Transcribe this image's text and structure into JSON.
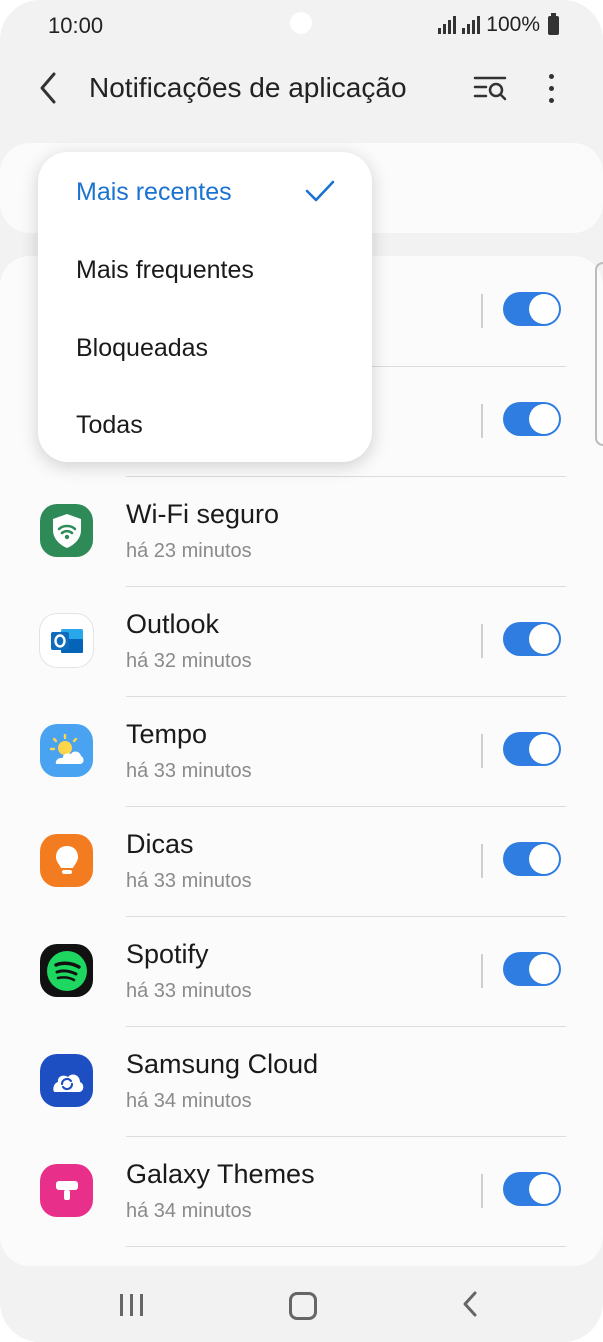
{
  "status_bar": {
    "time": "10:00",
    "battery": "100%"
  },
  "header": {
    "title": "Notificações de aplicação"
  },
  "sort_menu": {
    "options": [
      {
        "label": "Mais recentes",
        "selected": true
      },
      {
        "label": "Mais frequentes",
        "selected": false
      },
      {
        "label": "Bloqueadas",
        "selected": false
      },
      {
        "label": "Todas",
        "selected": false
      }
    ]
  },
  "apps": [
    {
      "name": "Wi-Fi seguro",
      "time": "há 23 minutos",
      "has_toggle": false,
      "toggle_on": false,
      "icon": "shield-wifi-icon",
      "color": "#2e8b57"
    },
    {
      "name": "Outlook",
      "time": "há 32 minutos",
      "has_toggle": true,
      "toggle_on": true,
      "icon": "outlook-icon",
      "color": "#0f6cbd"
    },
    {
      "name": "Tempo",
      "time": "há 33 minutos",
      "has_toggle": true,
      "toggle_on": true,
      "icon": "weather-icon",
      "color": "#4aa3f0"
    },
    {
      "name": "Dicas",
      "time": "há 33 minutos",
      "has_toggle": true,
      "toggle_on": true,
      "icon": "lightbulb-icon",
      "color": "#f47c20"
    },
    {
      "name": "Spotify",
      "time": "há 33 minutos",
      "has_toggle": true,
      "toggle_on": true,
      "icon": "spotify-icon",
      "color": "#1ed760"
    },
    {
      "name": "Samsung Cloud",
      "time": "há 34 minutos",
      "has_toggle": false,
      "toggle_on": false,
      "icon": "cloud-icon",
      "color": "#1e4fc2"
    },
    {
      "name": "Galaxy Themes",
      "time": "há 34 minutos",
      "has_toggle": true,
      "toggle_on": true,
      "icon": "themes-icon",
      "color": "#e8308a"
    }
  ],
  "colors": {
    "accent": "#2f7de1",
    "selected_text": "#1a73d1"
  }
}
